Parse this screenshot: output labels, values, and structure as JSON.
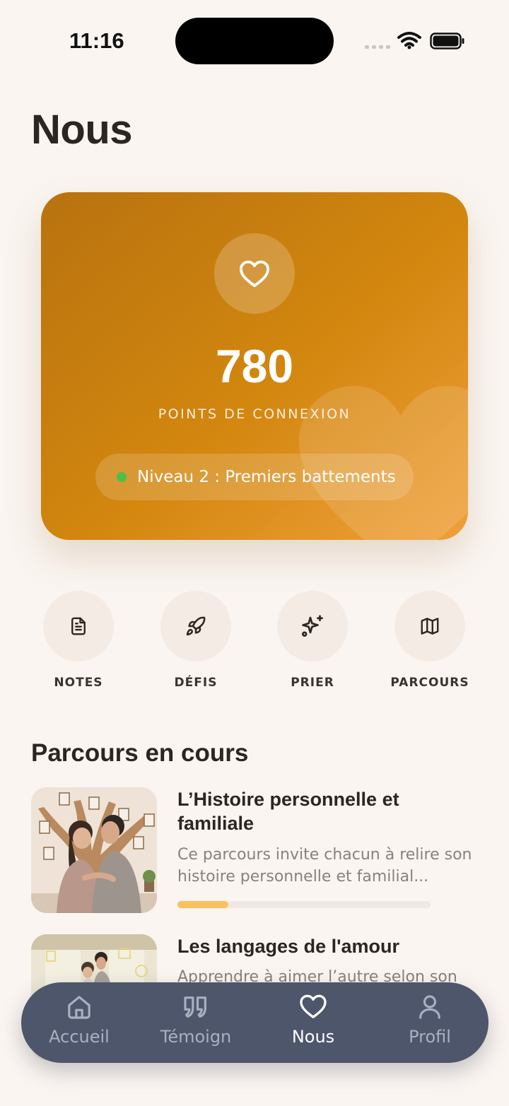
{
  "status_bar": {
    "time": "11:16"
  },
  "page": {
    "title": "Nous"
  },
  "hero": {
    "icon": "heart-icon",
    "points": "780",
    "points_label": "POINTS DE CONNEXION",
    "level": "Niveau 2 : Premiers battements",
    "level_dot_color": "#4cbf4a",
    "gradient_colors": [
      "#b8720f",
      "#d3870f",
      "#f0a03a"
    ]
  },
  "actions": [
    {
      "label": "NOTES",
      "icon": "document-icon"
    },
    {
      "label": "DÉFIS",
      "icon": "rocket-icon"
    },
    {
      "label": "PRIER",
      "icon": "sparkles-icon"
    },
    {
      "label": "PARCOURS",
      "icon": "map-icon"
    }
  ],
  "section": {
    "title": "Parcours en cours"
  },
  "courses": [
    {
      "title": "L’Histoire personnelle et familiale",
      "description": "Ce parcours invite chacun à relire son histoire personnelle et familial...",
      "progress": 0.2
    },
    {
      "title": "Les langages de l'amour",
      "description": "Apprendre à aimer l’autre selon son"
    }
  ],
  "bottom_nav": {
    "items": [
      {
        "label": "Accueil",
        "icon": "home-icon",
        "active": false
      },
      {
        "label": "Témoign",
        "icon": "quote-icon",
        "active": false
      },
      {
        "label": "Nous",
        "icon": "heart-icon",
        "active": true
      },
      {
        "label": "Profil",
        "icon": "user-icon",
        "active": false
      }
    ]
  },
  "colors": {
    "background": "#faf5f1",
    "accent": "#d3870f",
    "progress": "#fbc061",
    "nav_background": "#4e566b"
  }
}
